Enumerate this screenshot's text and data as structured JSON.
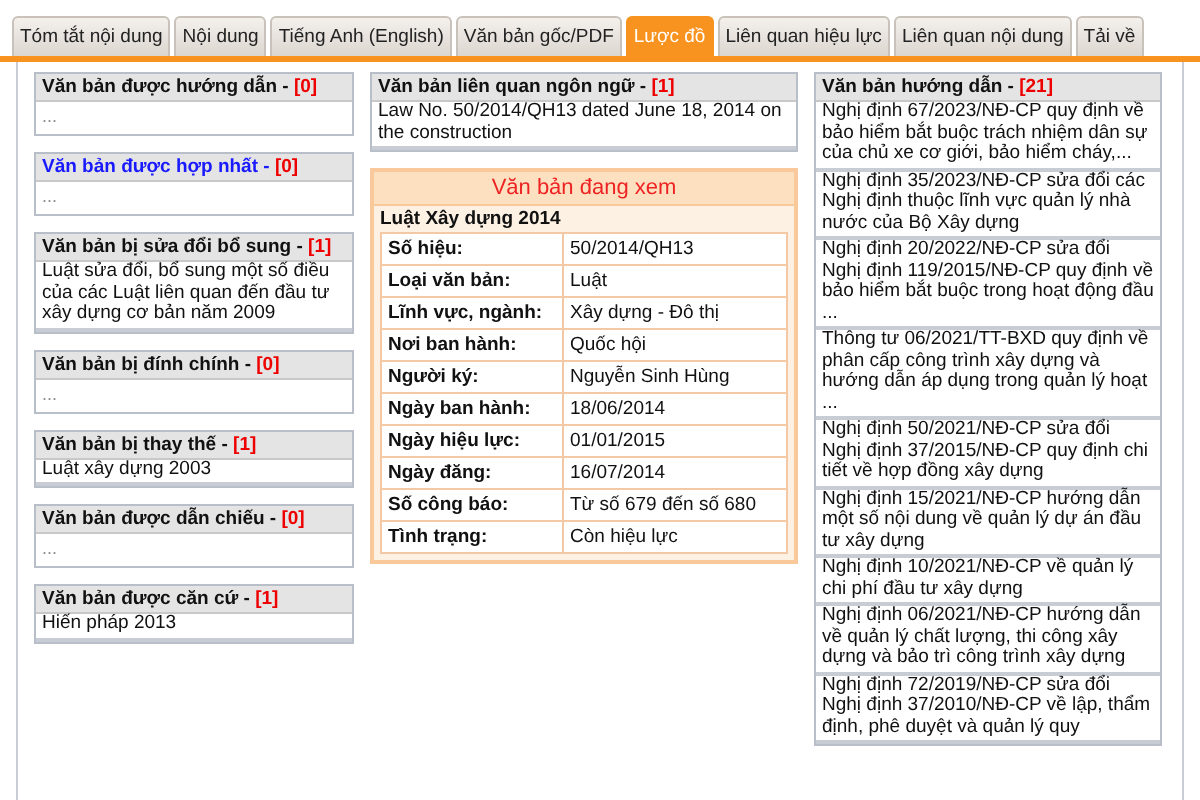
{
  "tabs": [
    {
      "label": "Tóm tắt nội dung",
      "selected": false
    },
    {
      "label": "Nội dung",
      "selected": false
    },
    {
      "label": "Tiếng Anh (English)",
      "selected": false
    },
    {
      "label": "Văn bản gốc/PDF",
      "selected": false
    },
    {
      "label": "Lược đồ",
      "selected": true
    },
    {
      "label": "Liên quan hiệu lực",
      "selected": false
    },
    {
      "label": "Liên quan nội dung",
      "selected": false
    },
    {
      "label": "Tải về",
      "selected": false
    }
  ],
  "left_column": [
    {
      "title": "Văn bản được hướng dẫn - ",
      "count": "[0]",
      "link": false,
      "empty": "..."
    },
    {
      "title": "Văn bản được hợp nhất - ",
      "count": "[0]",
      "link": true,
      "empty": "..."
    },
    {
      "title": "Văn bản bị sửa đổi bổ sung - ",
      "count": "[1]",
      "link": false,
      "items": [
        "Luật sửa đổi, bổ sung một số điều của các Luật liên quan đến đầu tư xây dựng cơ bản năm 2009"
      ]
    },
    {
      "title": "Văn bản bị đính chính - ",
      "count": "[0]",
      "link": false,
      "empty": "..."
    },
    {
      "title": "Văn bản bị thay thế - ",
      "count": "[1]",
      "link": false,
      "items": [
        "Luật xây dựng 2003"
      ]
    },
    {
      "title": "Văn bản được dẫn chiếu - ",
      "count": "[0]",
      "link": false,
      "empty": "..."
    },
    {
      "title": "Văn bản được căn cứ - ",
      "count": "[1]",
      "link": false,
      "items": [
        "Hiến pháp 2013"
      ]
    }
  ],
  "language_box": {
    "title": "Văn bản liên quan ngôn ngữ - ",
    "count": "[1]",
    "link": false,
    "items": [
      "Law No. 50/2014/QH13 dated June 18, 2014 on the construction"
    ]
  },
  "current_document": {
    "heading": "Văn bản đang xem",
    "title": "Luật Xây dựng 2014",
    "rows": [
      {
        "label": "Số hiệu:",
        "value": "50/2014/QH13"
      },
      {
        "label": "Loại văn bản:",
        "value": "Luật"
      },
      {
        "label": "Lĩnh vực, ngành:",
        "value": "Xây dựng - Đô thị"
      },
      {
        "label": "Nơi ban hành:",
        "value": "Quốc hội"
      },
      {
        "label": "Người ký:",
        "value": "Nguyễn Sinh Hùng"
      },
      {
        "label": "Ngày ban hành:",
        "value": "18/06/2014"
      },
      {
        "label": "Ngày hiệu lực:",
        "value": "01/01/2015"
      },
      {
        "label": "Ngày đăng:",
        "value": "16/07/2014"
      },
      {
        "label": "Số công báo:",
        "value": "Từ số 679 đến số 680"
      },
      {
        "label": "Tình trạng:",
        "value": "Còn hiệu lực"
      }
    ]
  },
  "right_column": {
    "title": "Văn bản hướng dẫn - ",
    "count": "[21]",
    "link": false,
    "items": [
      "Nghị định 67/2023/NĐ-CP quy định về bảo hiểm bắt buộc trách nhiệm dân sự của chủ xe cơ giới, bảo hiểm cháy,...",
      "Nghị định 35/2023/NĐ-CP sửa đổi các Nghị định thuộc lĩnh vực quản lý nhà nước của Bộ Xây dựng",
      "Nghị định 20/2022/NĐ-CP sửa đổi Nghị định 119/2015/NĐ-CP quy định về bảo hiểm bắt buộc trong hoạt động đầu ...",
      "Thông tư 06/2021/TT-BXD quy định về phân cấp công trình xây dựng và hướng dẫn áp dụng trong quản lý hoạt ...",
      "Nghị định 50/2021/NĐ-CP sửa đổi Nghị định 37/2015/NĐ-CP quy định chi tiết về hợp đồng xây dựng",
      "Nghị định 15/2021/NĐ-CP hướng dẫn một số nội dung về quản lý dự án đầu tư xây dựng",
      "Nghị định 10/2021/NĐ-CP về quản lý chi phí đầu tư xây dựng",
      "Nghị định 06/2021/NĐ-CP hướng dẫn về quản lý chất lượng, thi công xây dựng và bảo trì công trình xây dựng",
      "Nghị định 72/2019/NĐ-CP sửa đổi Nghị định 37/2010/NĐ-CP về lập, thẩm định, phê duyệt và quản lý quy"
    ]
  }
}
